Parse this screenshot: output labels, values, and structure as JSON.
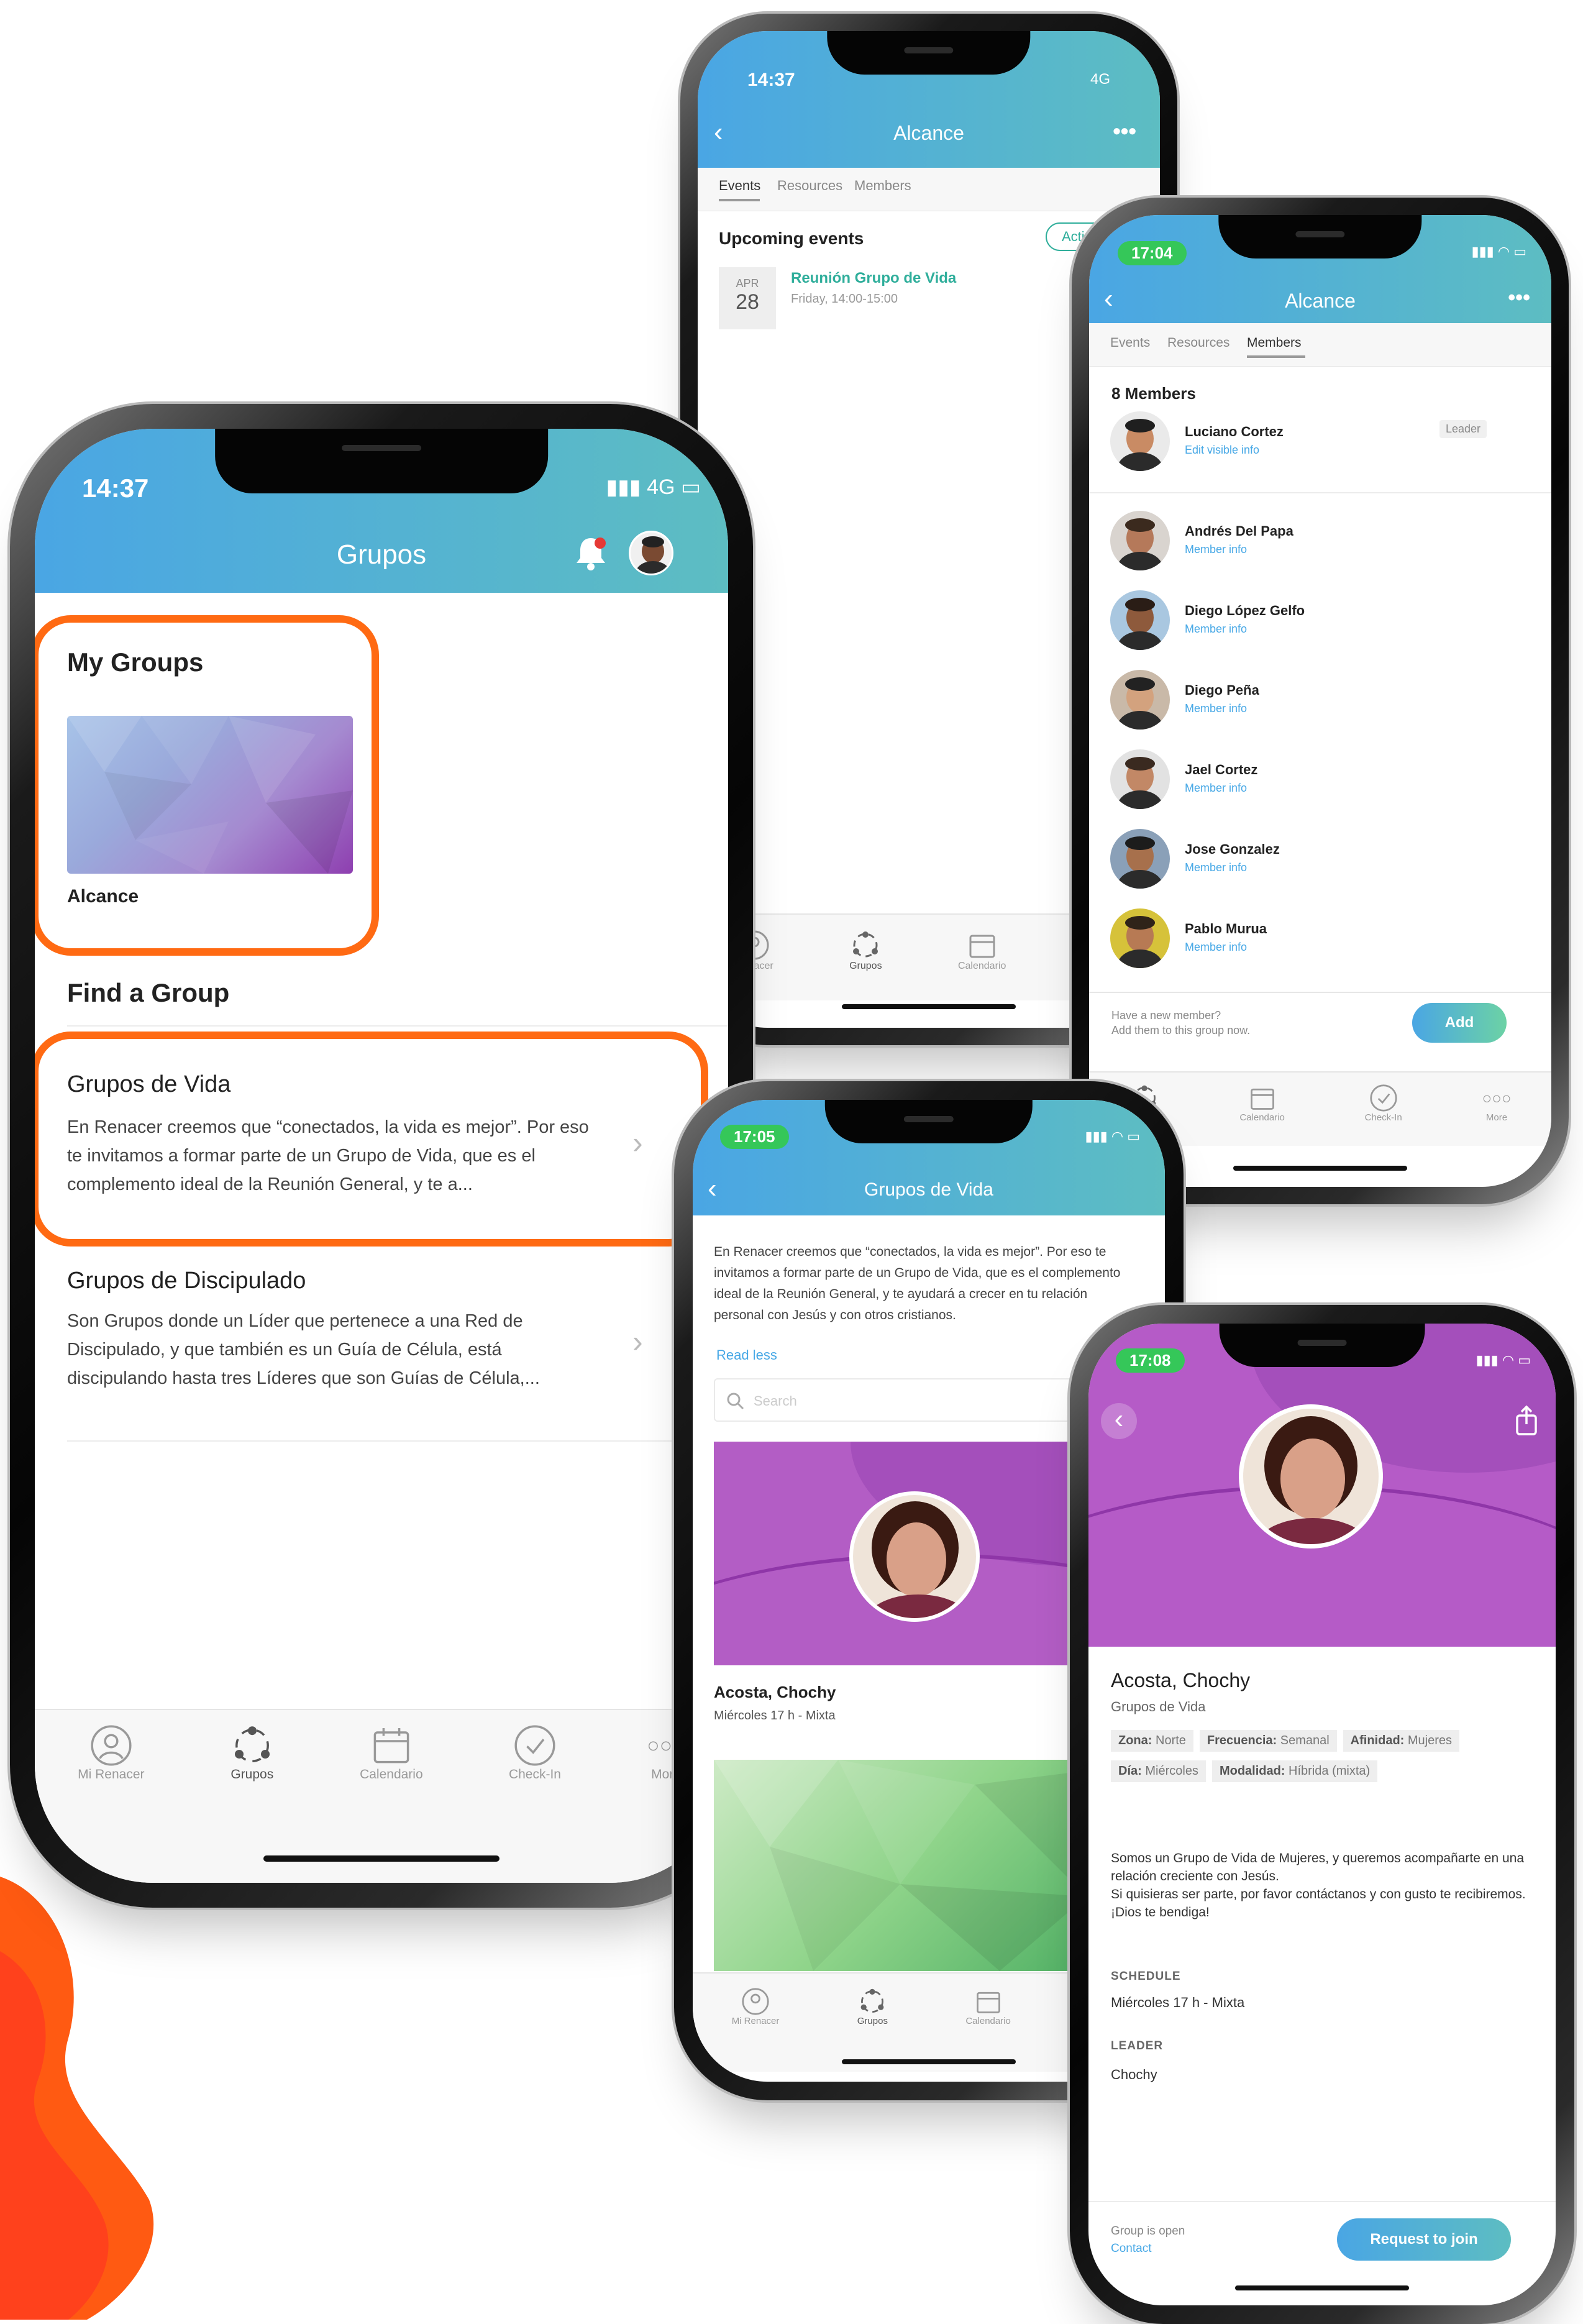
{
  "colors": {
    "header_start": "#4aa6e4",
    "header_end": "#5dbdc2",
    "highlight": "#ff6a13",
    "link": "#47a8e6",
    "purple": "#b158c6",
    "green": "#54b55a"
  },
  "tabbar": {
    "mi_renacer": "Mi Renacer",
    "renacer_short": "Renacer",
    "grupos": "Grupos",
    "calendario": "Calendario",
    "check_in": "Check-In",
    "more": "More"
  },
  "icons": [
    "user-circle-icon",
    "groups-icon",
    "calendar-icon",
    "check-circle-icon",
    "more-dots-icon",
    "bell-icon",
    "back-chevron-icon",
    "more-horizontal-icon",
    "share-icon",
    "search-icon",
    "chevron-right-icon"
  ],
  "phone_grupos": {
    "time": "14:37",
    "network": "4G",
    "title": "Grupos",
    "my_groups_heading": "My Groups",
    "my_group_name": "Alcance",
    "find_heading": "Find a Group",
    "groups": [
      {
        "name": "Grupos de Vida",
        "description": "En Renacer creemos que “conectados, la vida es mejor”. Por eso te invitamos a formar parte de un Grupo de Vida, que es el complemento ideal de la Reunión General, y te a..."
      },
      {
        "name": "Grupos de Discipulado",
        "description": "Son Grupos donde un Líder que pertenece a una Red de Discipulado, y que también es un Guía de Célula, está discipulando hasta tres Líderes que son Guías de Célula,..."
      }
    ]
  },
  "phone_events": {
    "time": "14:37",
    "network": "4G",
    "title": "Alcance",
    "tabs": [
      "Events",
      "Resources",
      "Members"
    ],
    "upcoming_heading": "Upcoming events",
    "actions_label": "Action",
    "event": {
      "month": "APR",
      "day": "28",
      "name": "Reunión Grupo de Vida",
      "when": "Friday, 14:00-15:00"
    }
  },
  "phone_members": {
    "time": "17:04",
    "title": "Alcance",
    "tabs": [
      "Events",
      "Resources",
      "Members"
    ],
    "count_label": "8 Members",
    "leader_badge": "Leader",
    "members": [
      {
        "name": "Luciano Cortez",
        "link": "Edit visible info"
      },
      {
        "name": "Andrés Del Papa",
        "link": "Member info"
      },
      {
        "name": "Diego López Gelfo",
        "link": "Member info"
      },
      {
        "name": "Diego Peña",
        "link": "Member info"
      },
      {
        "name": "Jael Cortez",
        "link": "Member info"
      },
      {
        "name": "Jose Gonzalez",
        "link": "Member info"
      },
      {
        "name": "Pablo Murua",
        "link": "Member info"
      }
    ],
    "new_member_q": "Have a new member?",
    "new_member_sub": "Add them to this group now.",
    "add_label": "Add"
  },
  "phone_vida": {
    "time": "17:05",
    "title": "Grupos de Vida",
    "intro": "En Renacer creemos que “conectados, la vida es mejor”. Por eso te invitamos a formar parte de un Grupo de Vida, que es el complemento ideal de la Reunión General, y te ayudará a crecer en tu relación personal con Jesús y con otros cristianos.",
    "read_less": "Read less",
    "search_placeholder": "Search",
    "card": {
      "name": "Acosta, Chochy",
      "schedule": "Miércoles 17 h - Mixta"
    }
  },
  "phone_detail": {
    "time": "17:08",
    "name": "Acosta, Chochy",
    "category": "Grupos de Vida",
    "tags": [
      {
        "key": "Zona:",
        "value": "Norte"
      },
      {
        "key": "Frecuencia:",
        "value": "Semanal"
      },
      {
        "key": "Afinidad:",
        "value": "Mujeres"
      },
      {
        "key": "Día:",
        "value": "Miércoles"
      },
      {
        "key": "Modalidad:",
        "value": "Híbrida (mixta)"
      }
    ],
    "description": "Somos un Grupo de Vida de Mujeres, y queremos acompañarte en una relación creciente con Jesús.\nSi quisieras ser parte, por favor contáctanos y con gusto te recibiremos. ¡Dios te bendiga!",
    "schedule_label": "SCHEDULE",
    "schedule_value": "Miércoles 17 h - Mixta",
    "leader_label": "LEADER",
    "leader_value": "Chochy",
    "open_label": "Group is open",
    "contact_label": "Contact",
    "request_label": "Request to join"
  }
}
